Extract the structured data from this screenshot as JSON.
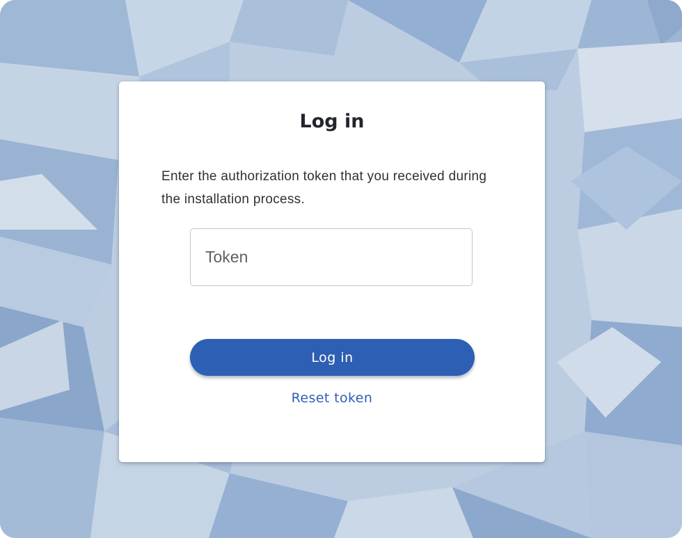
{
  "login": {
    "title": "Log in",
    "instructions": "Enter the authorization token that you received during the installation process.",
    "token_input": {
      "placeholder": "Token",
      "value": ""
    },
    "submit_label": "Log in",
    "reset_label": "Reset token"
  },
  "colors": {
    "accent": "#2d5fb4",
    "card_background": "#ffffff",
    "page_background": "#b9cbe0",
    "title_text": "#23252e"
  }
}
